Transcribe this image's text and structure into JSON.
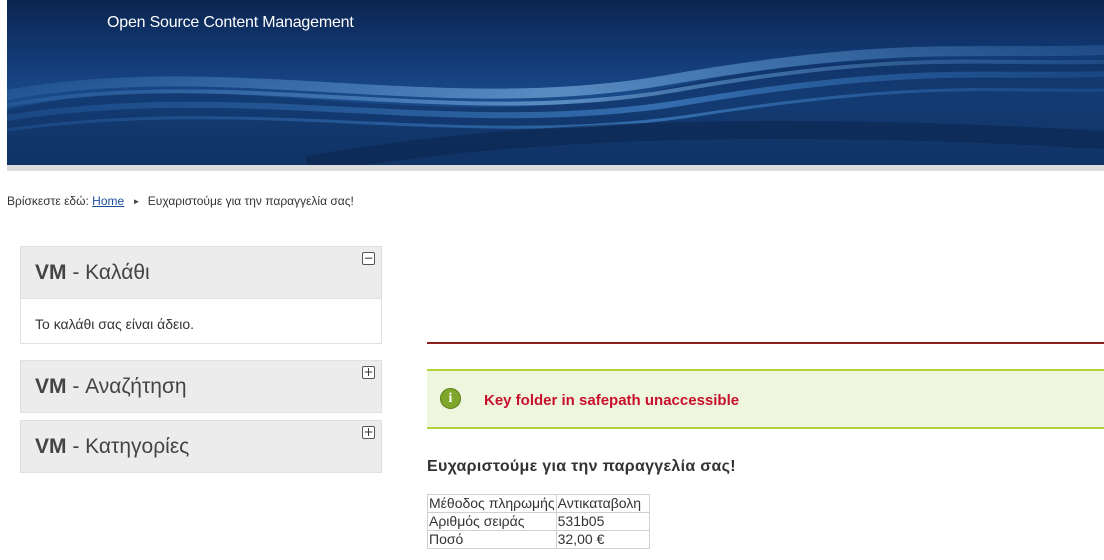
{
  "header": {
    "site_title": "Open Source Content Management"
  },
  "breadcrumb": {
    "prefix": "Βρίσκεστε εδώ:",
    "home_label": "Home",
    "separator": "►",
    "current": "Ευχαριστούμε για την παραγγελία σας!"
  },
  "sidebar": {
    "modules": [
      {
        "title_prefix": "VM",
        "title_rest": " - Καλάθι",
        "toggle": "−",
        "expanded": true,
        "body": "Το καλάθι σας είναι άδειο."
      },
      {
        "title_prefix": "VM",
        "title_rest": " - Αναζήτηση",
        "toggle": "+",
        "expanded": false
      },
      {
        "title_prefix": "VM",
        "title_rest": " - Κατηγορίες",
        "toggle": "+",
        "expanded": false
      }
    ]
  },
  "main": {
    "notice": {
      "icon": "info-icon",
      "icon_glyph": "i",
      "message": "Key folder in safepath unaccessible"
    },
    "thanks_title": "Ευχαριστούμε για την παραγγελία σας!",
    "order_table": [
      {
        "label": "Μέθοδος πληρωμής",
        "value": "Αντικαταβολη"
      },
      {
        "label": "Αριθμός σειράς",
        "value": "531b05"
      },
      {
        "label": "Ποσό",
        "value": "32,00 €"
      }
    ]
  },
  "colors": {
    "header_bg": "#123a75",
    "notice_border": "#b2d33c",
    "notice_bg": "#eef6dd",
    "notice_text": "#c8102e",
    "rule": "#8b1e1e",
    "link": "#1a4d9c"
  }
}
